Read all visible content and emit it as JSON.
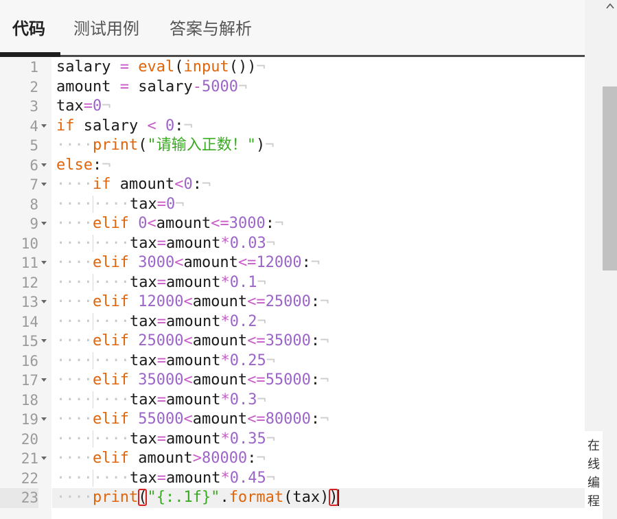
{
  "tabs": [
    {
      "label": "代码",
      "active": true
    },
    {
      "label": "测试用例",
      "active": false
    },
    {
      "label": "答案与解析",
      "active": false
    }
  ],
  "side_panel": {
    "label_chars": [
      "在",
      "线",
      "编",
      "程"
    ]
  },
  "editor": {
    "current_line": 23,
    "lines": [
      {
        "n": "1",
        "fold": false
      },
      {
        "n": "2",
        "fold": false
      },
      {
        "n": "3",
        "fold": false
      },
      {
        "n": "4",
        "fold": true
      },
      {
        "n": "5",
        "fold": false
      },
      {
        "n": "6",
        "fold": true
      },
      {
        "n": "7",
        "fold": true
      },
      {
        "n": "8",
        "fold": false
      },
      {
        "n": "9",
        "fold": true
      },
      {
        "n": "10",
        "fold": false
      },
      {
        "n": "11",
        "fold": true
      },
      {
        "n": "12",
        "fold": false
      },
      {
        "n": "13",
        "fold": true
      },
      {
        "n": "14",
        "fold": false
      },
      {
        "n": "15",
        "fold": true
      },
      {
        "n": "16",
        "fold": false
      },
      {
        "n": "17",
        "fold": true
      },
      {
        "n": "18",
        "fold": false
      },
      {
        "n": "19",
        "fold": true
      },
      {
        "n": "20",
        "fold": false
      },
      {
        "n": "21",
        "fold": true
      },
      {
        "n": "22",
        "fold": false
      },
      {
        "n": "23",
        "fold": false
      }
    ],
    "tokens": {
      "l1": {
        "a": "salary",
        "b": "=",
        "c": "eval",
        "d": "(",
        "e": "input",
        "f": "())"
      },
      "l2": {
        "a": "amount",
        "b": "=",
        "c": "salary",
        "d": "-",
        "e": "5000"
      },
      "l3": {
        "a": "tax",
        "b": "=",
        "c": "0"
      },
      "l4": {
        "a": "if",
        "b": "salary",
        "c": "<",
        "d": "0",
        "e": ":"
      },
      "l5": {
        "a": "print",
        "b": "(",
        "c": "\"请输入正数！\"",
        "d": ")"
      },
      "l6": {
        "a": "else",
        "b": ":"
      },
      "l7": {
        "a": "if",
        "b": "amount",
        "c": "<",
        "d": "0",
        "e": ":"
      },
      "l8": {
        "a": "tax",
        "b": "=",
        "c": "0"
      },
      "l9": {
        "a": "elif",
        "b": "0",
        "c": "<",
        "d": "amount",
        "e": "<=",
        "f": "3000",
        "g": ":"
      },
      "l10": {
        "a": "tax",
        "b": "=",
        "c": "amount",
        "d": "*",
        "e": "0.03"
      },
      "l11": {
        "a": "elif",
        "b": "3000",
        "c": "<",
        "d": "amount",
        "e": "<=",
        "f": "12000",
        "g": ":"
      },
      "l12": {
        "a": "tax",
        "b": "=",
        "c": "amount",
        "d": "*",
        "e": "0.1"
      },
      "l13": {
        "a": "elif",
        "b": "12000",
        "c": "<",
        "d": "amount",
        "e": "<=",
        "f": "25000",
        "g": ":"
      },
      "l14": {
        "a": "tax",
        "b": "=",
        "c": "amount",
        "d": "*",
        "e": "0.2"
      },
      "l15": {
        "a": "elif",
        "b": "25000",
        "c": "<",
        "d": "amount",
        "e": "<=",
        "f": "35000",
        "g": ":"
      },
      "l16": {
        "a": "tax",
        "b": "=",
        "c": "amount",
        "d": "*",
        "e": "0.25"
      },
      "l17": {
        "a": "elif",
        "b": "35000",
        "c": "<",
        "d": "amount",
        "e": "<=",
        "f": "55000",
        "g": ":"
      },
      "l18": {
        "a": "tax",
        "b": "=",
        "c": "amount",
        "d": "*",
        "e": "0.3"
      },
      "l19": {
        "a": "elif",
        "b": "55000",
        "c": "<",
        "d": "amount",
        "e": "<=",
        "f": "80000",
        "g": ":"
      },
      "l20": {
        "a": "tax",
        "b": "=",
        "c": "amount",
        "d": "*",
        "e": "0.35"
      },
      "l21": {
        "a": "elif",
        "b": "amount",
        "c": ">",
        "d": "80000",
        "e": ":"
      },
      "l22": {
        "a": "tax",
        "b": "=",
        "c": "amount",
        "d": "*",
        "e": "0.45"
      },
      "l23": {
        "a": "print",
        "b": "(",
        "c": "\"{:.1f}\"",
        "d": ".",
        "e": "format",
        "f": "(",
        "g": "tax",
        "h": ")",
        "i": ")"
      }
    }
  }
}
